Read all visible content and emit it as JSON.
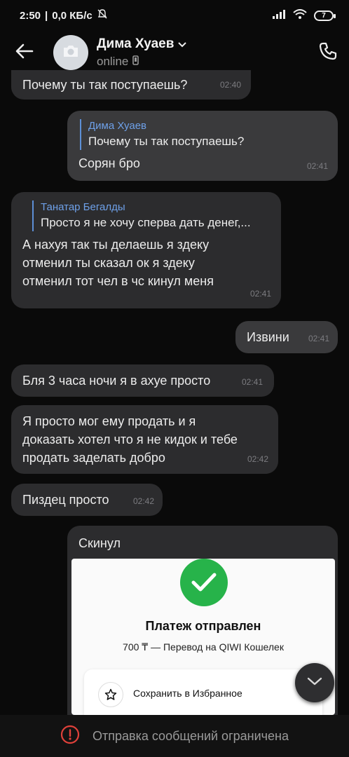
{
  "status_bar": {
    "time": "2:50",
    "speed": "0,0 КБ/с",
    "battery": "7"
  },
  "header": {
    "contact_name": "Дима Хуаев",
    "status": "online"
  },
  "messages": [
    {
      "text": "Почему ты так поступаешь?",
      "time": "02:40"
    },
    {
      "reply_author": "Дима Хуаев",
      "reply_text": "Почему ты так поступаешь?",
      "text": "Сорян бро",
      "time": "02:41"
    },
    {
      "reply_author": "Танатар Бегалды",
      "reply_text": "Просто я не хочу сперва дать денег,...",
      "text": "А нахуя так ты делаешь я здеку\nотменил ты сказал ок я здеку\nотменил тот чел в чс кинул меня",
      "time": "02:41"
    },
    {
      "text": "Извини",
      "time": "02:41"
    },
    {
      "text": "Бля 3 часа ночи я в ахуе просто",
      "time": "02:41"
    },
    {
      "text": "Я просто мог ему продать и я\nдоказать хотел что я не кидок и тебе\nпродать заделать добро",
      "time": "02:42"
    },
    {
      "text": "Пиздец просто",
      "time": "02:42"
    },
    {
      "text": "Скинул"
    }
  ],
  "receipt": {
    "title": "Платеж отправлен",
    "subtitle": "700 ₸ — Перевод на QIWI Кошелек",
    "save_label": "Сохранить в Избранное"
  },
  "bottom": {
    "notice": "Отправка сообщений ограничена"
  },
  "colors": {
    "background": "#0a0a0a",
    "bubble_in": "#2c2c2e",
    "bubble_out": "#3a3a3c",
    "reply_accent": "#6ea0e8",
    "success": "#27b34a",
    "warning": "#e0413a"
  },
  "icons": {
    "back": "arrow-left-icon",
    "avatar": "camera-icon",
    "call": "phone-icon",
    "scroll": "chevron-down-icon",
    "notice": "exclamation-circle-icon",
    "favorite": "star-icon"
  }
}
